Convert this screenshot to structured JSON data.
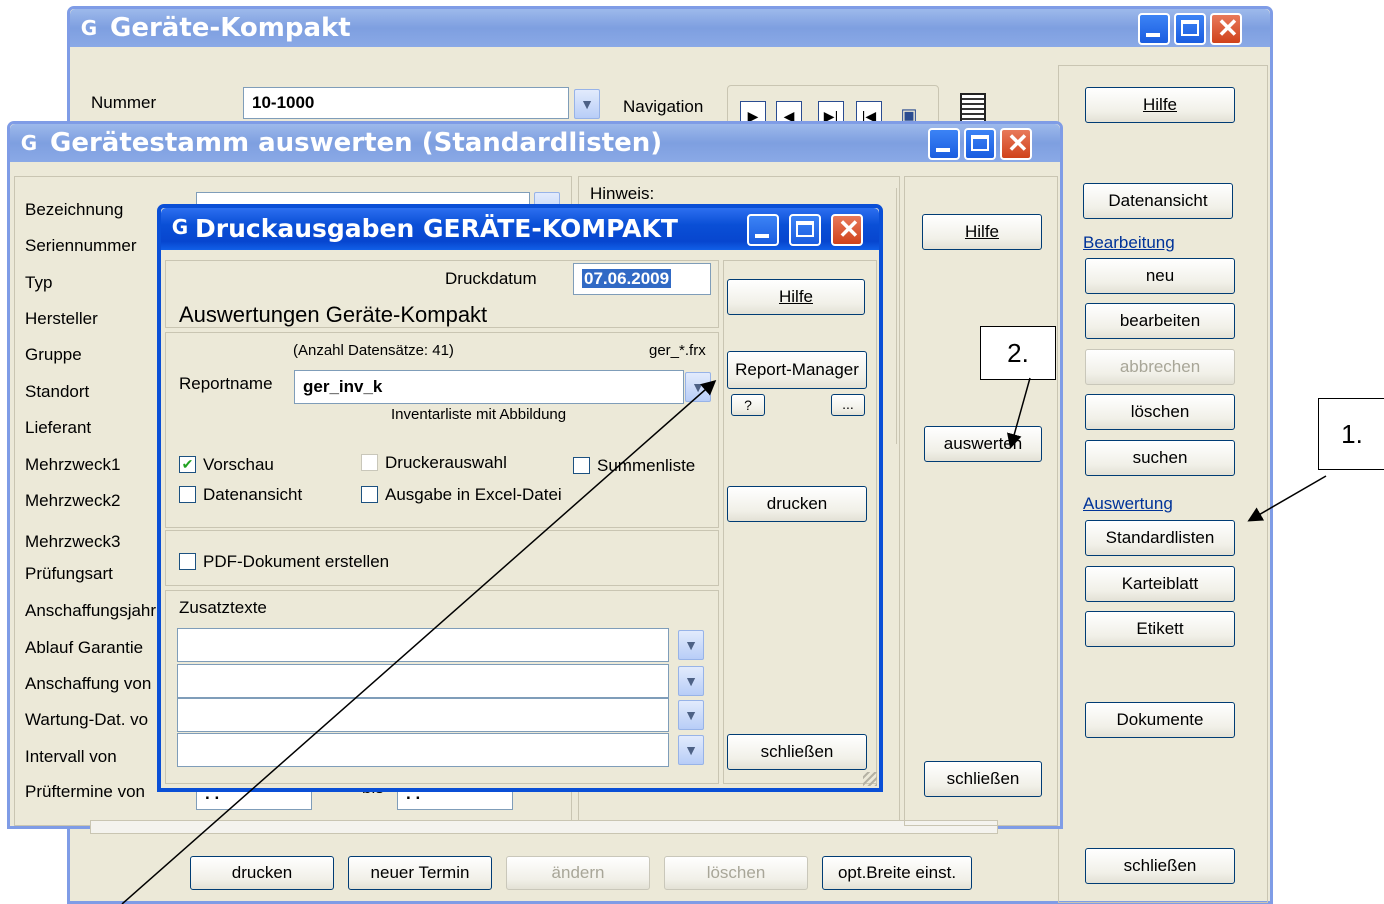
{
  "win_main": {
    "title": "Geräte-Kompakt",
    "nummer_label": "Nummer",
    "nummer_value": "10-1000",
    "navigation_label": "Navigation",
    "side_buttons": {
      "hilfe": "Hilfe",
      "datenansicht": "Datenansicht",
      "bearbeitung_label": "Bearbeitung",
      "neu": "neu",
      "bearbeiten": "bearbeiten",
      "abbrechen": "abbrechen",
      "loeschen": "löschen",
      "suchen": "suchen",
      "auswertung_label": "Auswertung",
      "standardlisten": "Standardlisten",
      "karteiblatt": "Karteiblatt",
      "etikett": "Etikett",
      "dokumente": "Dokumente",
      "schliessen": "schließen"
    },
    "bottom_buttons": {
      "drucken": "drucken",
      "neuer_termin": "neuer Termin",
      "aendern": "ändern",
      "loeschen": "löschen",
      "opt_breite": "opt.Breite einst."
    }
  },
  "win_geraetestamm": {
    "title": "Gerätestamm auswerten (Standardlisten)",
    "fields": [
      "Bezeichnung",
      "Seriennummer",
      "Typ",
      "Hersteller",
      "Gruppe",
      "Standort",
      "Lieferant",
      "Mehrzweck1",
      "Mehrzweck2",
      "Mehrzweck3",
      "Prüfungsart",
      "Anschaffungsjahr",
      "Ablauf Garantie",
      "Anschaffung von",
      "Wartung-Dat. vo",
      "Intervall von",
      "Prüftermine von"
    ],
    "hinweis_label": "Hinweis:",
    "bis_label": "bis",
    "date_placeholder": ". .",
    "hilfe": "Hilfe",
    "auswerten": "auswerten",
    "schliessen": "schließen"
  },
  "win_druck": {
    "title": "Druckausgaben  GERÄTE-KOMPAKT",
    "druckdatum_label": "Druckdatum",
    "druckdatum_value": "07.06.2009",
    "auswertungen_label": "Auswertungen Geräte-Kompakt",
    "anzahl": "(Anzahl Datensätze: 41)",
    "frx": "ger_*.frx",
    "reportname_label": "Reportname",
    "reportname_value": "ger_inv_k",
    "report_desc": "Inventarliste mit Abbildung",
    "vorschau": "Vorschau",
    "druckerauswahl": "Druckerauswahl",
    "summenliste": "Summenliste",
    "datenansicht": "Datenansicht",
    "excel": "Ausgabe in Excel-Datei",
    "pdf": "PDF-Dokument erstellen",
    "zusatztexte": "Zusatztexte",
    "hilfe": "Hilfe",
    "report_manager": "Report-Manager",
    "help_q": "?",
    "ellipsis": "...",
    "drucken": "drucken",
    "schliessen": "schließen"
  },
  "callouts": {
    "one": "1.",
    "two": "2."
  }
}
